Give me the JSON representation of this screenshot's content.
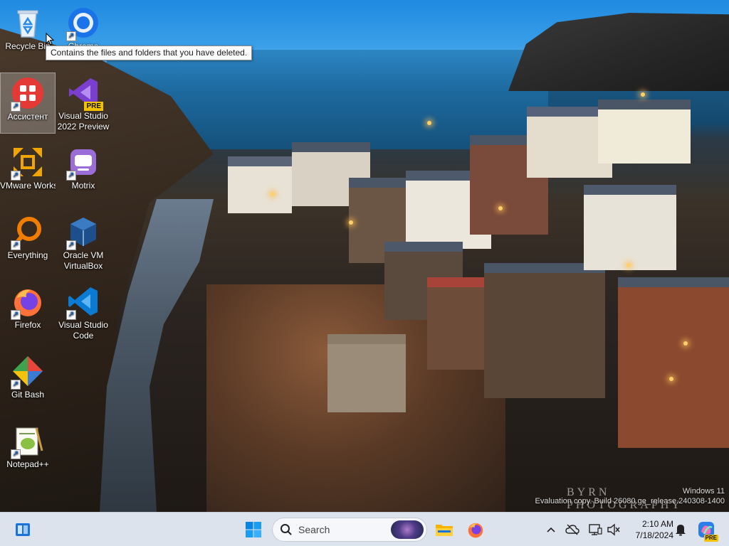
{
  "desktop": {
    "icons": [
      {
        "label": "Recycle Bin",
        "icon": "recycle-bin-icon"
      },
      {
        "label": "Chrome",
        "icon": "chrome-icon"
      },
      {
        "label": "Ассистент",
        "icon": "assistant-icon"
      },
      {
        "label": "Visual Studio 2022 Preview",
        "icon": "visual-studio-preview-icon",
        "badge": "PRE"
      },
      {
        "label": "VMware Workstation",
        "icon": "vmware-icon"
      },
      {
        "label": "Motrix",
        "icon": "motrix-icon"
      },
      {
        "label": "Everything",
        "icon": "everything-icon"
      },
      {
        "label": "Oracle VM VirtualBox",
        "icon": "virtualbox-icon"
      },
      {
        "label": "Firefox",
        "icon": "firefox-icon"
      },
      {
        "label": "Visual Studio Code",
        "icon": "vscode-icon"
      },
      {
        "label": "Git Bash",
        "icon": "git-bash-icon"
      },
      {
        "label": "Notepad++",
        "icon": "notepadpp-icon"
      }
    ],
    "tooltip": "Contains the files and folders that you have deleted.",
    "watermark_line1": "Windows 11",
    "watermark_line2": "Evaluation copy. Build 26080.ge_release.240308-1400",
    "photo_credit": "BYRN PHOTOGRAPHY"
  },
  "taskbar": {
    "search_placeholder": "Search",
    "pinned": [
      "start-button",
      "search",
      "file-explorer",
      "firefox"
    ],
    "clock_time": "2:10 AM",
    "clock_date": "7/18/2024",
    "copilot_badge": "PRE"
  },
  "colors": {
    "taskbar_bg": "#dde3ec",
    "windows_blue": "#0078d4"
  }
}
